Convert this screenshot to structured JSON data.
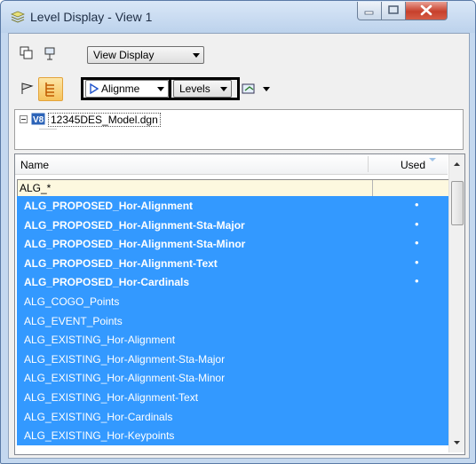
{
  "window": {
    "title": "Level Display - View 1"
  },
  "toolbar": {
    "view_mode": "View Display",
    "filter_dropdown": "Alignme",
    "levels_dropdown": "Levels"
  },
  "tree": {
    "file": "12345DES_Model.dgn"
  },
  "table": {
    "col_name": "Name",
    "col_used": "Used",
    "filter_value": "ALG_*",
    "rows": [
      {
        "name": "ALG_PROPOSED_Hor-Alignment",
        "used": "•",
        "bold": true
      },
      {
        "name": "ALG_PROPOSED_Hor-Alignment-Sta-Major",
        "used": "•",
        "bold": true
      },
      {
        "name": "ALG_PROPOSED_Hor-Alignment-Sta-Minor",
        "used": "•",
        "bold": true
      },
      {
        "name": "ALG_PROPOSED_Hor-Alignment-Text",
        "used": "•",
        "bold": true
      },
      {
        "name": "ALG_PROPOSED_Hor-Cardinals",
        "used": "•",
        "bold": true
      },
      {
        "name": "ALG_COGO_Points",
        "used": "",
        "bold": false
      },
      {
        "name": "ALG_EVENT_Points",
        "used": "",
        "bold": false
      },
      {
        "name": "ALG_EXISTING_Hor-Alignment",
        "used": "",
        "bold": false
      },
      {
        "name": "ALG_EXISTING_Hor-Alignment-Sta-Major",
        "used": "",
        "bold": false
      },
      {
        "name": "ALG_EXISTING_Hor-Alignment-Sta-Minor",
        "used": "",
        "bold": false
      },
      {
        "name": "ALG_EXISTING_Hor-Alignment-Text",
        "used": "",
        "bold": false
      },
      {
        "name": "ALG_EXISTING_Hor-Cardinals",
        "used": "",
        "bold": false
      },
      {
        "name": "ALG_EXISTING_Hor-Keypoints",
        "used": "",
        "bold": false
      }
    ]
  }
}
